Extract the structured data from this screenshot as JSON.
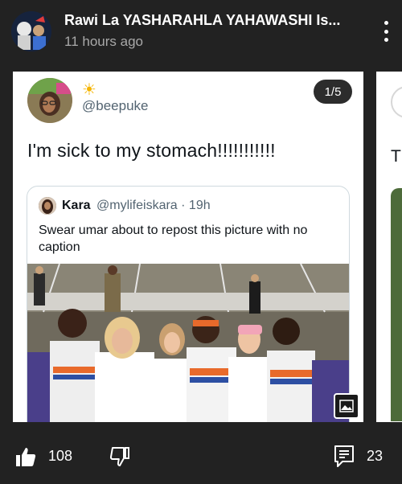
{
  "post": {
    "author": "Rawi La YASHARAHLA YAHAWASHI Is...",
    "time": "11 hours ago",
    "avatar_icon": "user-avatar",
    "more_icon": "more-vertical-icon"
  },
  "tweet": {
    "emoji": "☀",
    "handle": "@beepuke",
    "text": "I'm sick to my stomach!!!!!!!!!!!",
    "counter": "1/5",
    "quote": {
      "name": "Kara",
      "handle_time": "@mylifeiskara · 19h",
      "text": "Swear umar about to repost this picture with no caption"
    }
  },
  "next_card": {
    "text_start": "T"
  },
  "footer": {
    "like_count": "108",
    "comment_count": "23",
    "like_icon": "thumbs-up-icon",
    "dislike_icon": "thumbs-down-icon",
    "comment_icon": "comment-icon"
  },
  "colors": {
    "background": "#222222",
    "card": "#ffffff",
    "muted_text": "#a9a9a9",
    "handle_text": "#536471",
    "jersey_orange": "#e86a2b",
    "jersey_blue": "#2d4fa3"
  }
}
